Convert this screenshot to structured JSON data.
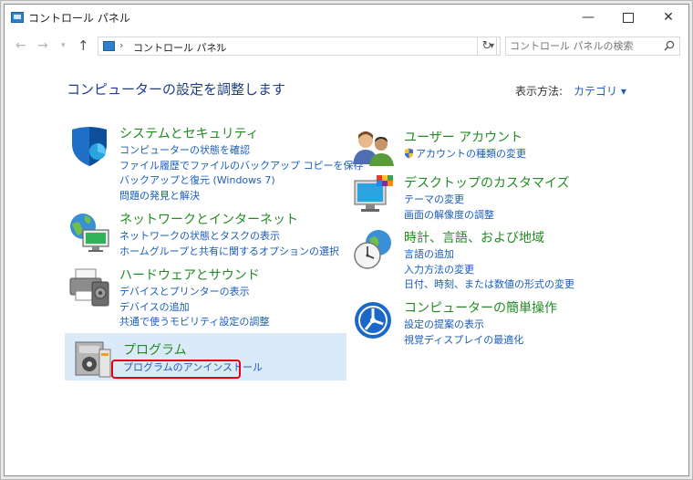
{
  "window": {
    "title": "コントロール パネル",
    "min_glyph": "—",
    "close_glyph": "✕"
  },
  "nav": {
    "back_glyph": "←",
    "forward_glyph": "→",
    "dropdown_glyph": "▾",
    "up_glyph": "↑",
    "address_sep": "›",
    "address_text": "コントロール パネル",
    "address_dropdown_glyph": "▾",
    "refresh_glyph": "↻",
    "search_placeholder": "コントロール パネルの検索"
  },
  "page": {
    "title": "コンピューターの設定を調整します",
    "view_label": "表示方法:",
    "view_value": "カテゴリ ▾"
  },
  "categories_left": [
    {
      "title": "システムとセキュリティ",
      "icon": "shield-icon",
      "links": [
        "コンピューターの状態を確認",
        "ファイル履歴でファイルのバックアップ コピーを保存",
        "バックアップと復元 (Windows 7)",
        "問題の発見と解決"
      ]
    },
    {
      "title": "ネットワークとインターネット",
      "icon": "network-globe-icon",
      "links": [
        "ネットワークの状態とタスクの表示",
        "ホームグループと共有に関するオプションの選択"
      ]
    },
    {
      "title": "ハードウェアとサウンド",
      "icon": "printer-icon",
      "links": [
        "デバイスとプリンターの表示",
        "デバイスの追加",
        "共通で使うモビリティ設定の調整"
      ]
    },
    {
      "title": "プログラム",
      "icon": "programs-icon",
      "links": [
        "プログラムのアンインストール"
      ]
    }
  ],
  "categories_right": [
    {
      "title": "ユーザー アカウント",
      "icon": "users-icon",
      "links": [
        "アカウントの種類の変更"
      ]
    },
    {
      "title": "デスクトップのカスタマイズ",
      "icon": "monitor-palette-icon",
      "links": [
        "テーマの変更",
        "画面の解像度の調整"
      ]
    },
    {
      "title": "時計、言語、および地域",
      "icon": "clock-globe-icon",
      "links": [
        "言語の追加",
        "入力方法の変更",
        "日付、時刻、または数値の形式の変更"
      ]
    },
    {
      "title": "コンピューターの簡単操作",
      "icon": "ease-of-access-icon",
      "links": [
        "設定の提案の表示",
        "視覚ディスプレイの最適化"
      ]
    }
  ],
  "colors": {
    "category_title": "#228b22",
    "link": "#1a5dbb",
    "heading": "#1e3c8a",
    "highlight_border": "#e60012",
    "selected_bg": "#dbeaf8"
  }
}
